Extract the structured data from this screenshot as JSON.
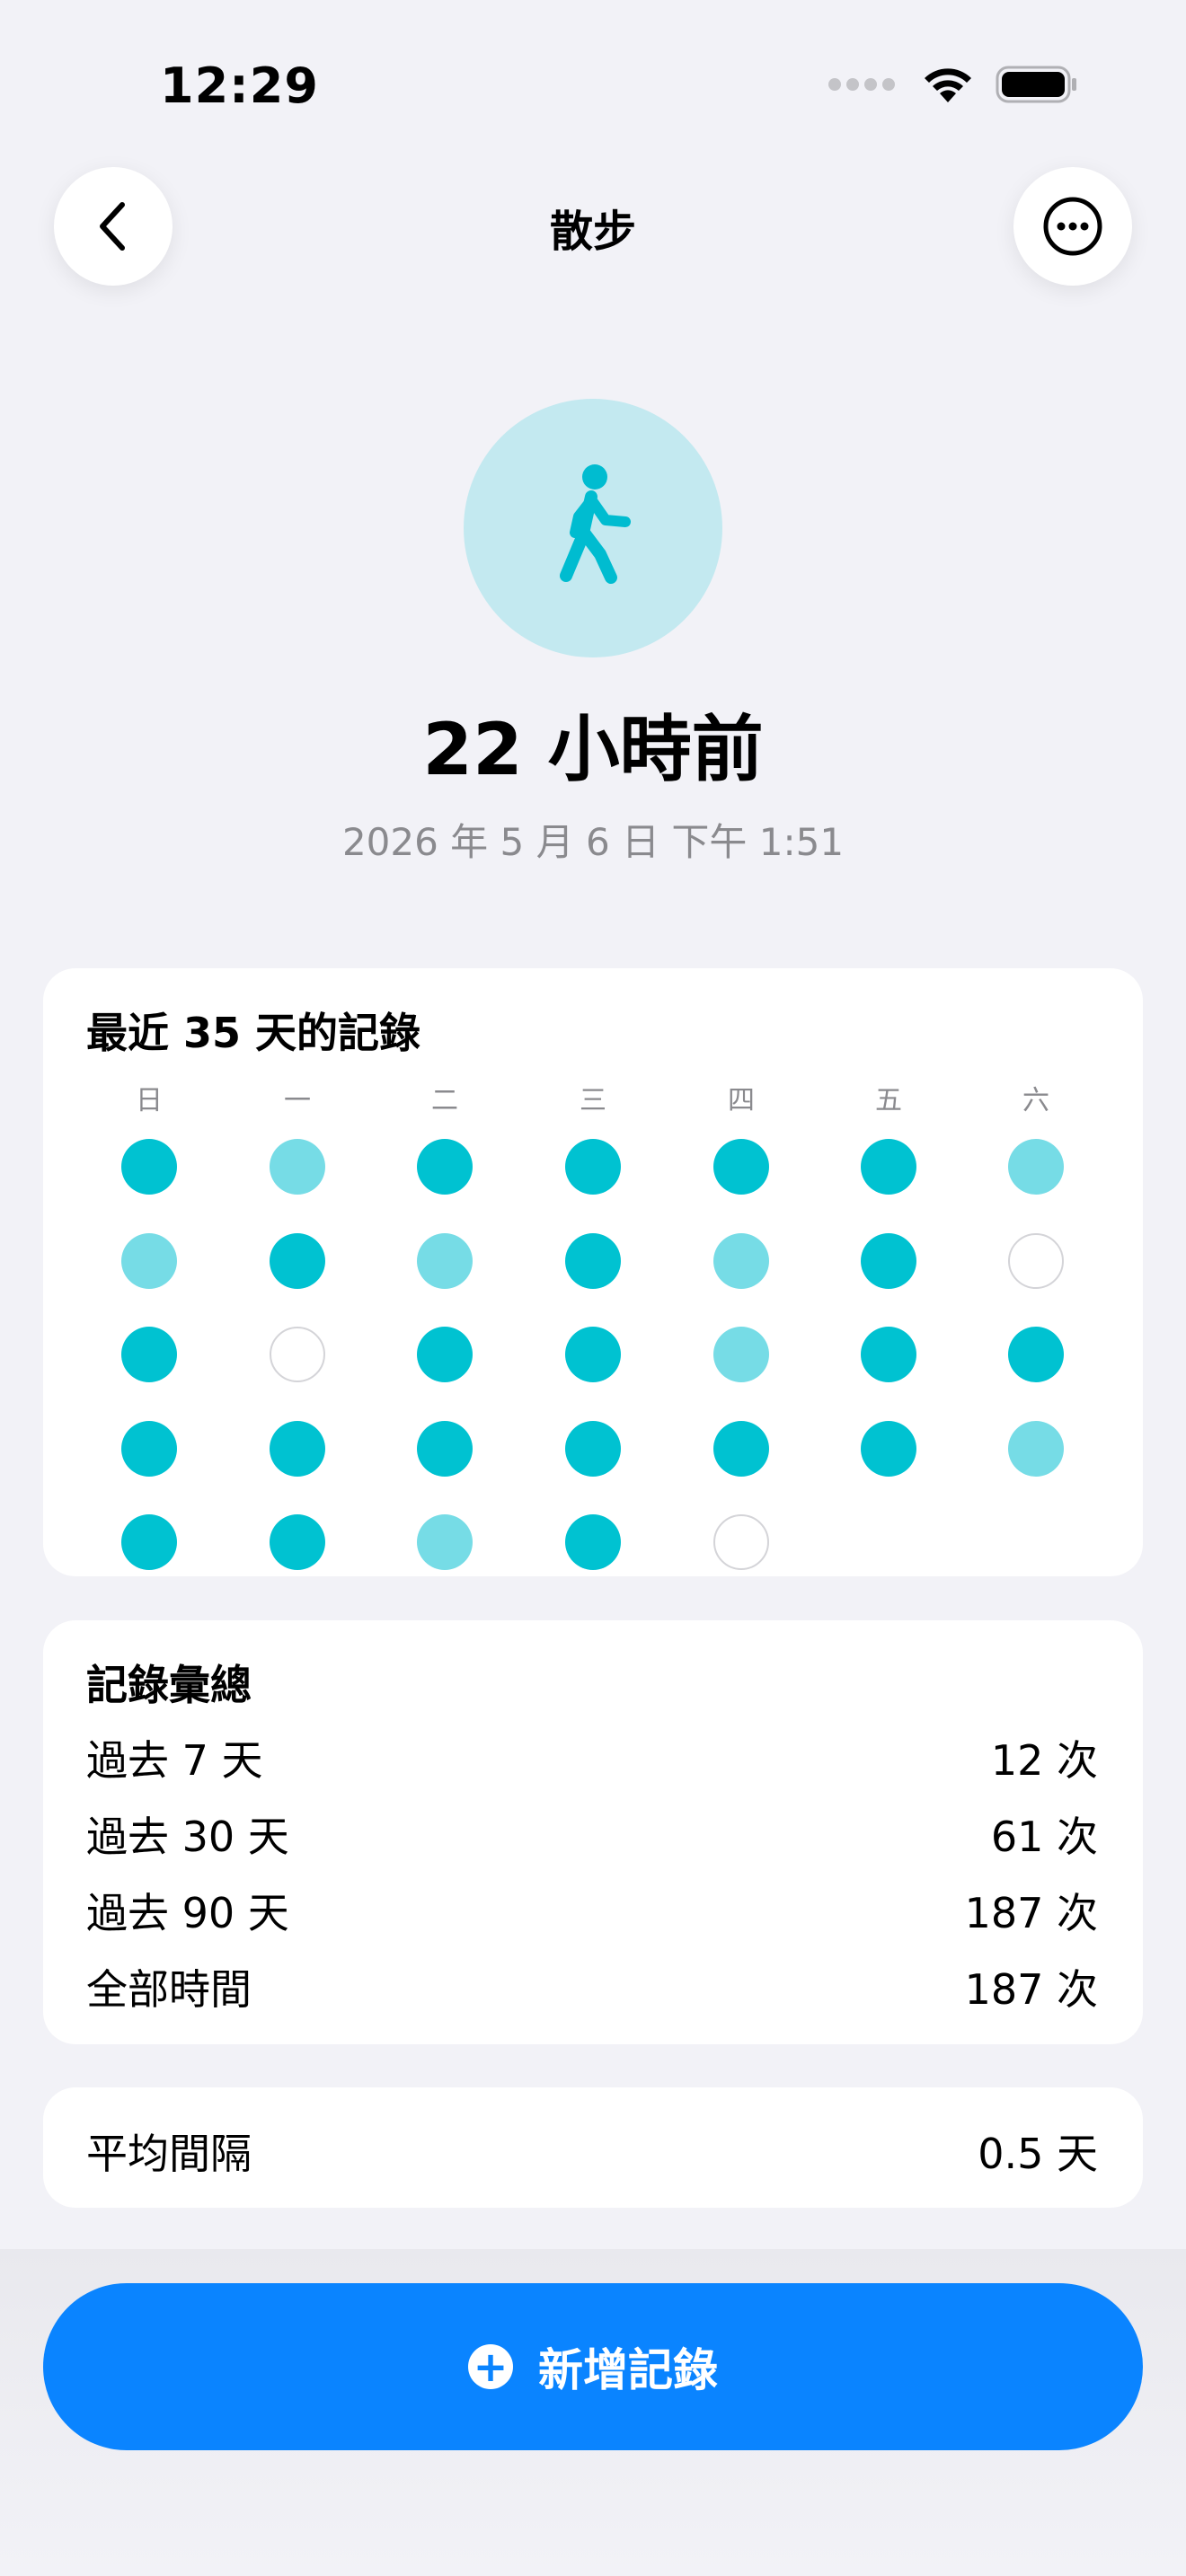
{
  "status_bar": {
    "time": "12:29"
  },
  "nav": {
    "title": "散步"
  },
  "hero": {
    "icon": "walking-figure-icon",
    "relative_time": "22 小時前",
    "absolute_time": "2026 年 5 月 6 日 下午 1:51"
  },
  "calendar": {
    "title": "最近 35 天的記錄",
    "weekdays": [
      "日",
      "一",
      "二",
      "三",
      "四",
      "五",
      "六"
    ],
    "weeks": [
      [
        "full",
        "light",
        "full",
        "full",
        "full",
        "full",
        "light"
      ],
      [
        "light",
        "full",
        "light",
        "full",
        "light",
        "full",
        "empty"
      ],
      [
        "full",
        "empty",
        "full",
        "full",
        "light",
        "full",
        "full"
      ],
      [
        "full",
        "full",
        "full",
        "full",
        "full",
        "full",
        "light"
      ],
      [
        "full",
        "full",
        "light",
        "full",
        "empty"
      ]
    ]
  },
  "summary": {
    "title": "記錄彙總",
    "rows": [
      {
        "label": "過去 7 天",
        "value": "12 次"
      },
      {
        "label": "過去 30 天",
        "value": "61 次"
      },
      {
        "label": "過去 90 天",
        "value": "187 次"
      },
      {
        "label": "全部時間",
        "value": "187 次"
      }
    ]
  },
  "average": {
    "label": "平均間隔",
    "value": "0.5 天"
  },
  "add_button": {
    "label": "新增記錄",
    "icon": "plus-circle-icon"
  },
  "colors": {
    "accent": "#0A84FF",
    "dot_full": "#00C2D1",
    "dot_light": "#76DCE6",
    "hero_circle": "#C3E9F0"
  }
}
